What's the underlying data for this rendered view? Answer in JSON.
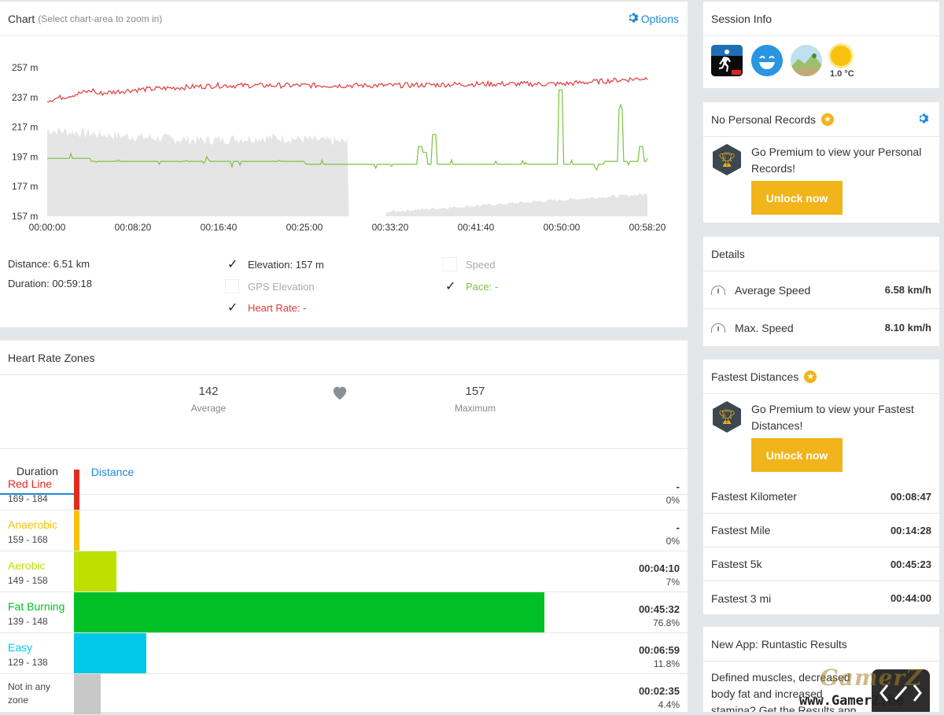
{
  "chart": {
    "title": "Chart",
    "subtitle": "(Select chart-area to zoom in)",
    "options_label": "Options",
    "y_ticks": [
      "257 m",
      "237 m",
      "217 m",
      "197 m",
      "177 m",
      "157 m"
    ],
    "x_ticks": [
      "00:00:00",
      "00:08:20",
      "00:16:40",
      "00:25:00",
      "00:33:20",
      "00:41:40",
      "00:50:00",
      "00:58:20"
    ],
    "distance": "Distance: 6.51 km",
    "duration": "Duration: 00:59:18",
    "series_toggles": {
      "elevation": {
        "label": "Elevation: 157 m",
        "checked": true,
        "color": "#333333"
      },
      "gps_elevation": {
        "label": "GPS Elevation",
        "checked": false,
        "color": "#aaaaaa"
      },
      "heart_rate": {
        "label": "Heart Rate: -",
        "checked": true,
        "color": "#e03b3b"
      },
      "speed": {
        "label": "Speed",
        "checked": false,
        "color": "#aaaaaa"
      },
      "pace": {
        "label": "Pace: -",
        "checked": true,
        "color": "#7cc242"
      }
    }
  },
  "chart_data": {
    "type": "area",
    "title": "",
    "xlabel": "",
    "ylabel": "",
    "ylim": [
      157,
      257
    ],
    "x": [
      "00:00:00",
      "00:08:20",
      "00:16:40",
      "00:25:00",
      "00:33:20",
      "00:41:40",
      "00:50:00",
      "00:58:20"
    ],
    "series": [
      {
        "name": "Elevation",
        "color": "#e5e5e5",
        "type": "area",
        "values": [
          215,
          208,
          210,
          207,
          160,
          162,
          167,
          172
        ]
      },
      {
        "name": "Heart Rate",
        "color": "#e03b3b",
        "type": "line",
        "values": [
          236,
          242,
          245,
          245,
          245,
          246,
          246,
          250
        ]
      },
      {
        "name": "Pace",
        "color": "#7cc242",
        "type": "line",
        "values": [
          197,
          193,
          193,
          193,
          191,
          193,
          191,
          195
        ]
      }
    ]
  },
  "heart_rate_zones": {
    "title": "Heart Rate Zones",
    "average": {
      "value": "142",
      "label": "Average"
    },
    "maximum": {
      "value": "157",
      "label": "Maximum"
    },
    "tabs": [
      "Duration",
      "Distance"
    ],
    "zones": [
      {
        "name": "Red Line",
        "range": "169 - 184",
        "time": "-",
        "pct": "0%",
        "fraction": 0.0,
        "color": "#e02b20"
      },
      {
        "name": "Anaerobic",
        "range": "159 - 168",
        "time": "-",
        "pct": "0%",
        "fraction": 0.0,
        "color": "#f6c20f"
      },
      {
        "name": "Aerobic",
        "range": "149 - 158",
        "time": "00:04:10",
        "pct": "7%",
        "fraction": 0.07,
        "color": "#bee000"
      },
      {
        "name": "Fat Burning",
        "range": "139 - 148",
        "time": "00:45:32",
        "pct": "76.8%",
        "fraction": 0.768,
        "color": "#00c026"
      },
      {
        "name": "Easy",
        "range": "129 - 138",
        "time": "00:06:59",
        "pct": "11.8%",
        "fraction": 0.118,
        "color": "#00c8e8"
      },
      {
        "name": "Not in any zone",
        "range": "",
        "time": "00:02:35",
        "pct": "4.4%",
        "fraction": 0.044,
        "color": "#c8c8c8"
      }
    ]
  },
  "session_info": {
    "title": "Session Info",
    "temperature": "1.0 °C"
  },
  "personal_records": {
    "title": "No Personal Records",
    "promo": "Go Premium to view your Personal Records!",
    "button": "Unlock now"
  },
  "details": {
    "title": "Details",
    "rows": [
      {
        "label": "Average Speed",
        "value": "6.58 km/h"
      },
      {
        "label": "Max. Speed",
        "value": "8.10 km/h"
      }
    ]
  },
  "fastest": {
    "title": "Fastest Distances",
    "promo": "Go Premium to view your Fastest Distances!",
    "button": "Unlock now",
    "rows": [
      {
        "label": "Fastest Kilometer",
        "value": "00:08:47"
      },
      {
        "label": "Fastest Mile",
        "value": "00:14:28"
      },
      {
        "label": "Fastest 5k",
        "value": "00:45:23"
      },
      {
        "label": "Fastest 3 mi",
        "value": "00:44:00"
      }
    ]
  },
  "new_app": {
    "title": "New App: Runtastic Results",
    "text": "Defined muscles, decreased body fat and increased stamina? Get the Results app",
    "watermark": "GamerZ",
    "watermark_url": "www.GamerZ.be"
  }
}
